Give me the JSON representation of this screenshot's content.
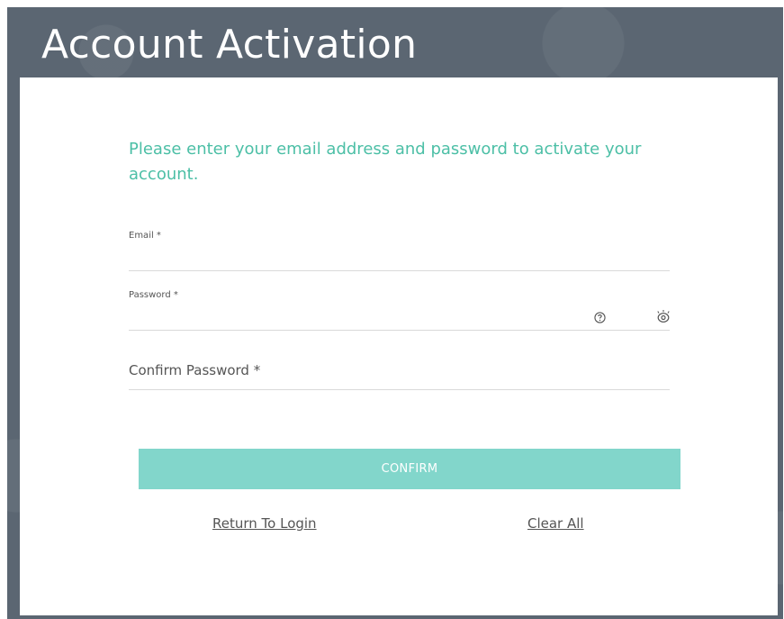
{
  "page": {
    "title": "Account Activation",
    "intro": "Please enter your email address and password to activate your account."
  },
  "form": {
    "email_label": "Email *",
    "email_value": "",
    "password_label": "Password *",
    "password_value": "",
    "confirm_password_label": "Confirm Password *",
    "confirm_password_value": ""
  },
  "actions": {
    "confirm_label": "CONFIRM",
    "return_label": "Return To Login",
    "clear_label": "Clear All"
  },
  "icons": {
    "help": "help-circle-icon",
    "visibility": "eye-icon"
  },
  "colors": {
    "header_bg": "#5b6672",
    "accent": "#4cbfa6",
    "button_bg": "#82d6cb"
  }
}
